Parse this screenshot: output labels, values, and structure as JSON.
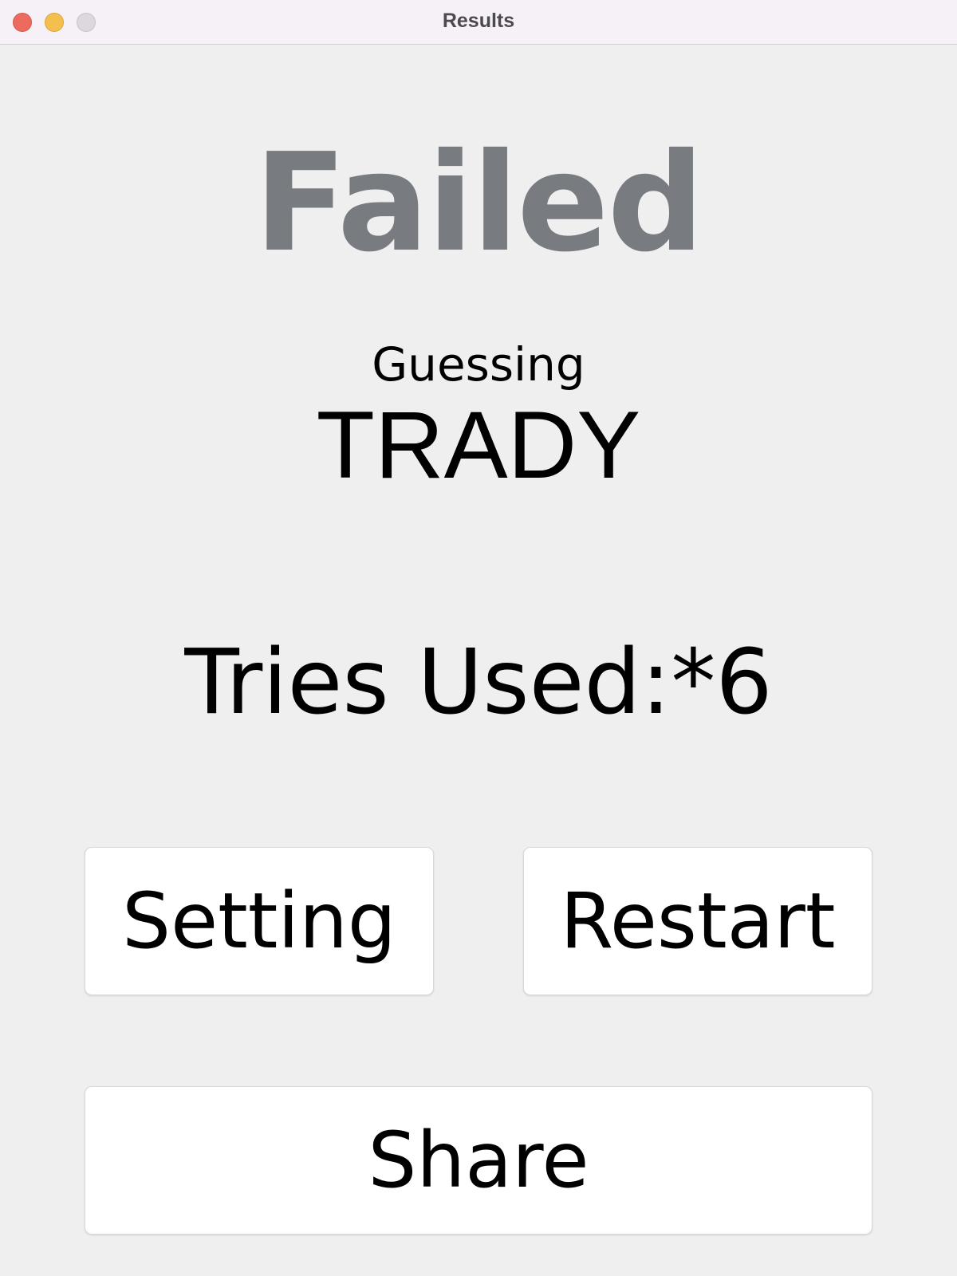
{
  "window": {
    "title": "Results"
  },
  "result": {
    "status": "Failed",
    "guess_label": "Guessing",
    "answer": "TRADY",
    "tries_text": "Tries Used:*6"
  },
  "buttons": {
    "setting": "Setting",
    "restart": "Restart",
    "share": "Share"
  },
  "colors": {
    "status_text": "#787b7f",
    "background": "#efefef",
    "titlebar": "#f6f0f7",
    "close": "#ed6a5e",
    "minimize": "#f5bf4f",
    "zoom": "#dcd8dd"
  },
  "icons": {
    "close": "close-dot-icon",
    "minimize": "minimize-dot-icon",
    "zoom": "zoom-dot-icon"
  }
}
